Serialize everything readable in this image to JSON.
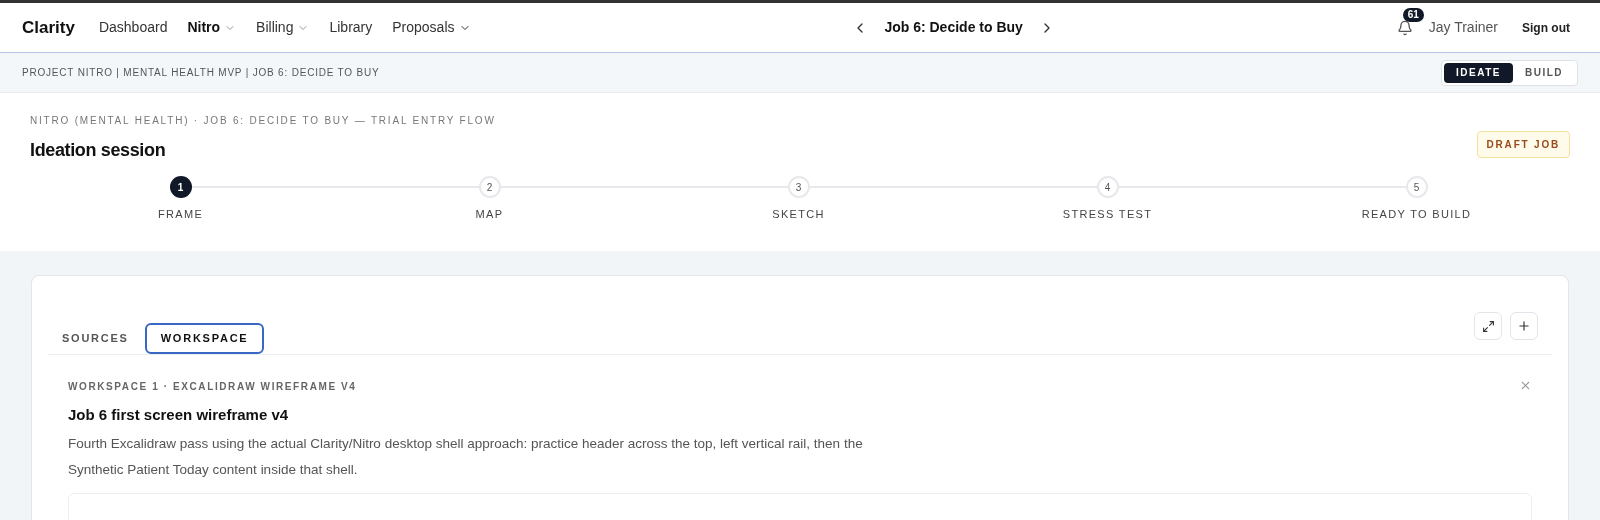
{
  "header": {
    "logo": "Clarity",
    "nav": [
      {
        "label": "Dashboard",
        "selected": false,
        "has_menu": false
      },
      {
        "label": "Nitro",
        "selected": true,
        "has_menu": true
      },
      {
        "label": "Billing",
        "selected": false,
        "has_menu": true
      },
      {
        "label": "Library",
        "selected": false,
        "has_menu": false
      },
      {
        "label": "Proposals",
        "selected": false,
        "has_menu": true
      }
    ],
    "job_title": "Job 6: Decide to Buy",
    "notifications": "61",
    "user": "Jay Trainer",
    "sign_out": "Sign out"
  },
  "breadcrumb": "PROJECT NITRO | MENTAL HEALTH MVP | JOB 6: DECIDE TO BUY",
  "mode_toggle": [
    {
      "label": "IDEATE",
      "selected": true
    },
    {
      "label": "BUILD",
      "selected": false
    }
  ],
  "session": {
    "eyebrow": "NITRO (MENTAL HEALTH) · JOB 6: DECIDE TO BUY — TRIAL ENTRY FLOW",
    "title": "Ideation session",
    "badge": "DRAFT JOB",
    "steps": [
      {
        "number": "1",
        "label": "FRAME",
        "selected": true
      },
      {
        "number": "2",
        "label": "MAP",
        "selected": false
      },
      {
        "number": "3",
        "label": "SKETCH",
        "selected": false
      },
      {
        "number": "4",
        "label": "STRESS TEST",
        "selected": false
      },
      {
        "number": "5",
        "label": "READY TO BUILD",
        "selected": false
      }
    ]
  },
  "panel": {
    "tabs": [
      {
        "label": "SOURCES",
        "selected": false
      },
      {
        "label": "WORKSPACE",
        "selected": true
      }
    ],
    "workspace": {
      "eyebrow": "WORKSPACE 1 · EXCALIDRAW WIREFRAME V4",
      "title": "Job 6 first screen wireframe v4",
      "description": "Fourth Excalidraw pass using the actual Clarity/Nitro desktop shell approach: practice header across the top, left vertical rail, then the Synthetic Patient Today content inside that shell."
    }
  }
}
